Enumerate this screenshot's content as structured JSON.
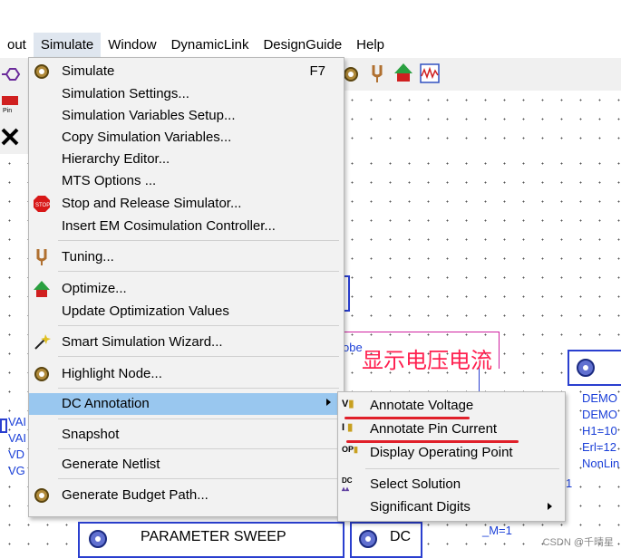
{
  "menubar": {
    "items": [
      "out",
      "Simulate",
      "Window",
      "DynamicLink",
      "DesignGuide",
      "Help"
    ]
  },
  "simulate_menu": {
    "items": [
      {
        "label": "Simulate",
        "shortcut": "F7",
        "icon": "gear-sim-icon"
      },
      {
        "label": "Simulation Settings...",
        "shortcut": "",
        "icon": ""
      },
      {
        "label": "Simulation Variables Setup...",
        "shortcut": "",
        "icon": ""
      },
      {
        "label": "Copy Simulation Variables...",
        "shortcut": "",
        "icon": ""
      },
      {
        "label": "Hierarchy Editor...",
        "shortcut": "",
        "icon": ""
      },
      {
        "label": "MTS Options ...",
        "shortcut": "",
        "icon": ""
      },
      {
        "label": "Stop and Release Simulator...",
        "shortcut": "",
        "icon": "stop-icon"
      },
      {
        "label": "Insert EM Cosimulation Controller...",
        "shortcut": "",
        "icon": ""
      },
      {
        "label": "Tuning...",
        "shortcut": "",
        "icon": "tuning-fork-icon"
      },
      {
        "label": "Optimize...",
        "shortcut": "",
        "icon": "optimize-arrow-icon"
      },
      {
        "label": "Update Optimization Values",
        "shortcut": "",
        "icon": ""
      },
      {
        "label": "Smart Simulation Wizard...",
        "shortcut": "",
        "icon": "wizard-wand-icon"
      },
      {
        "label": "Highlight Node...",
        "shortcut": "",
        "icon": "highlight-gear-icon"
      },
      {
        "label": "DC Annotation",
        "shortcut": "",
        "icon": ""
      },
      {
        "label": "Snapshot",
        "shortcut": "",
        "icon": ""
      },
      {
        "label": "Generate Netlist",
        "shortcut": "",
        "icon": ""
      },
      {
        "label": "Generate Budget Path...",
        "shortcut": "",
        "icon": "budget-gear-icon"
      }
    ]
  },
  "dc_annotation_submenu": {
    "items": [
      {
        "label": "Annotate Voltage",
        "icon_text": "V"
      },
      {
        "label": "Annotate Pin Current",
        "icon_text": "I"
      },
      {
        "label": "Display Operating Point",
        "icon_text": "OP"
      },
      {
        "label": "Select Solution",
        "icon_text": "DC"
      },
      {
        "label": "Significant Digits",
        "icon_text": ""
      }
    ]
  },
  "annotation_text": "显示电压电流",
  "schematic": {
    "left_labels": [
      "VAI",
      "VAI",
      "VD",
      "VG"
    ],
    "right_labels": [
      "DEMO",
      "DEMO",
      "H1=10",
      "Erl=12",
      "NonLin"
    ],
    "probe_label": "obe",
    "param_sweep_label": "PARAMETER SWEEP",
    "dc_label": "DC",
    "m_label": "_M=1",
    "side_number": "1"
  },
  "watermark": "CSDN @千晴星",
  "colors": {
    "highlight": "#99c7ef",
    "menu_bg": "#f2f2f2",
    "annotation_red": "#ff1f4f",
    "underline_red": "#e0202a",
    "schematic_blue": "#1a3fd8"
  }
}
